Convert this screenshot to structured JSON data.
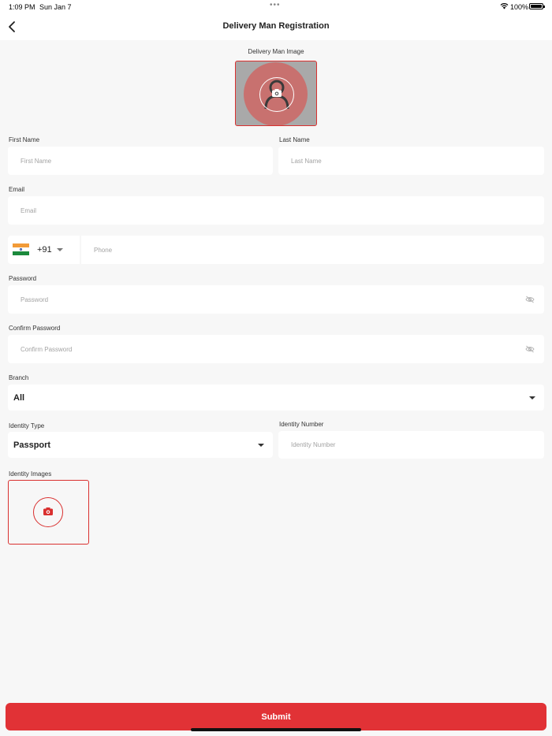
{
  "status_bar": {
    "time": "1:09 PM",
    "date": "Sun Jan 7",
    "battery": "100%"
  },
  "app_bar": {
    "title": "Delivery Man Registration",
    "back_icon": "chevron-left-icon"
  },
  "form": {
    "image_label": "Delivery Man Image",
    "first_name": {
      "label": "First Name",
      "placeholder": "First Name",
      "value": ""
    },
    "last_name": {
      "label": "Last Name",
      "placeholder": "Last Name",
      "value": ""
    },
    "email": {
      "label": "Email",
      "placeholder": "Email",
      "value": ""
    },
    "phone": {
      "country_code": "+91",
      "flag": "india-flag-icon",
      "placeholder": "Phone",
      "value": ""
    },
    "password": {
      "label": "Password",
      "placeholder": "Password",
      "value": ""
    },
    "confirm_password": {
      "label": "Confirm Password",
      "placeholder": "Confirm Password",
      "value": ""
    },
    "branch": {
      "label": "Branch",
      "selected": "All"
    },
    "identity_type": {
      "label": "Identity Type",
      "selected": "Passport"
    },
    "identity_number": {
      "label": "Identity Number",
      "placeholder": "Identity Number",
      "value": ""
    },
    "identity_images_label": "Identity Images"
  },
  "submit_label": "Submit",
  "colors": {
    "accent": "#e13236",
    "background": "#f7f7f7",
    "field": "#ffffff"
  }
}
